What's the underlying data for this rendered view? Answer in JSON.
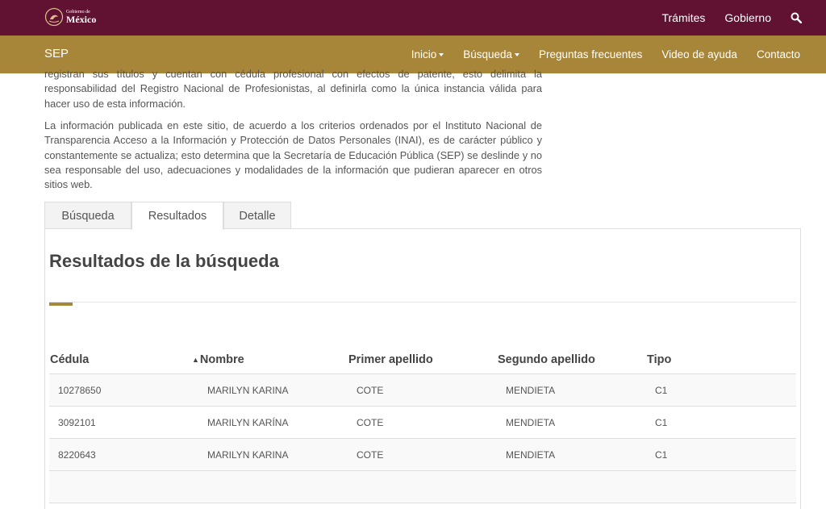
{
  "header": {
    "logo_small": "Gobierno de",
    "logo_big": "México",
    "links": [
      "Trámites",
      "Gobierno"
    ],
    "search_icon": "search-icon"
  },
  "nav": {
    "brand": "SEP",
    "items": [
      {
        "label": "Inicio",
        "dropdown": true
      },
      {
        "label": "Búsqueda",
        "dropdown": true
      },
      {
        "label": "Preguntas frecuentes",
        "dropdown": false
      },
      {
        "label": "Video de ayuda",
        "dropdown": false
      },
      {
        "label": "Contacto",
        "dropdown": false
      }
    ]
  },
  "intro": {
    "p1": "registran sus títulos y cuentan con cédula profesional con efectos de patente, esto delimita la responsabilidad del Registro Nacional de Profesionistas, al definirla como la única instancia válida para hacer uso de esta información.",
    "p2": "La información publicada en este sitio, de acuerdo a los criterios ordenados por el Instituto Nacional de Transparencia  Acceso a la Información y Protección de Datos Personales (INAI), es de carácter público y constantemente se actualiza; esto determina que la Secretaría de Educación Pública (SEP) se deslinde y no sea responsable del uso, adecuaciones y modalidades de la información que pudieran aparecer en otros sitios web."
  },
  "tabs": [
    "Búsqueda",
    "Resultados",
    "Detalle"
  ],
  "results": {
    "title": "Resultados de la búsqueda",
    "columns": [
      "Cédula",
      "Nombre",
      "Primer apellido",
      "Segundo apellido",
      "Tipo"
    ],
    "rows": [
      [
        "10278650",
        "MARILYN KARINA",
        "COTE",
        "MENDIETA",
        "C1"
      ],
      [
        "3092101",
        "MARILYN KARÍNA",
        "COTE",
        "MENDIETA",
        "C1"
      ],
      [
        "8220643",
        "MARILYN KARINA",
        "COTE",
        "MENDIETA",
        "C1"
      ]
    ]
  },
  "colors": {
    "topbar": "#611232",
    "navbar": "#a88639"
  }
}
